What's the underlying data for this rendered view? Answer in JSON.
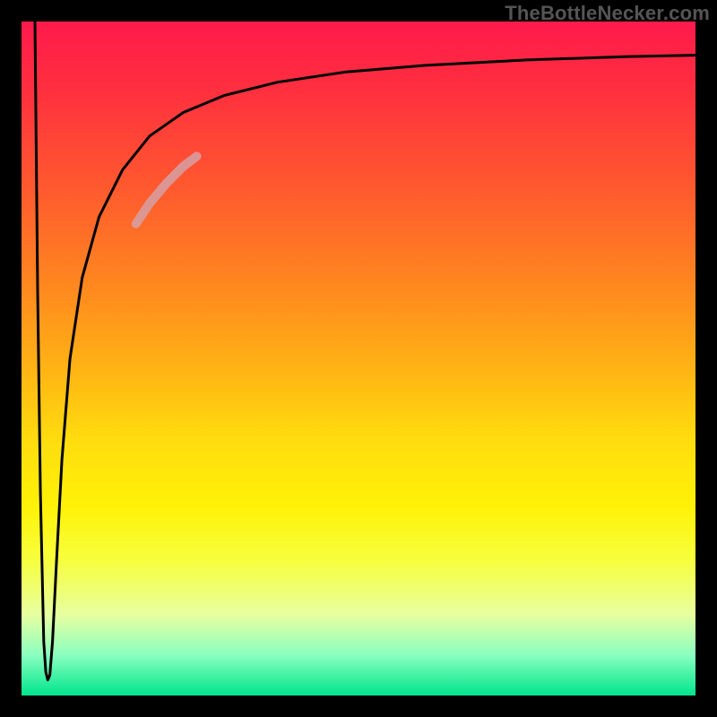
{
  "watermark": "TheBottleNecker.com",
  "chart_data": {
    "type": "line",
    "title": "",
    "xlabel": "",
    "ylabel": "",
    "xlim": [
      0,
      100
    ],
    "ylim": [
      0,
      100
    ],
    "background_gradient": {
      "direction": "vertical",
      "stops": [
        {
          "pos": 0.0,
          "color": "#ff1a4b"
        },
        {
          "pos": 0.5,
          "color": "#ffa91a"
        },
        {
          "pos": 0.75,
          "color": "#fff000"
        },
        {
          "pos": 1.0,
          "color": "#00e58c"
        }
      ]
    },
    "series": [
      {
        "name": "curve",
        "color": "#000000",
        "x": [
          2.0,
          2.4,
          2.8,
          3.3,
          3.6,
          3.9,
          4.2,
          4.6,
          5.2,
          6.0,
          7.2,
          9.0,
          11.5,
          15.0,
          19.0,
          24.0,
          30.0,
          38.0,
          48.0,
          60.0,
          75.0,
          90.0,
          100.0
        ],
        "y": [
          100.0,
          60.0,
          30.0,
          8.0,
          3.5,
          2.3,
          3.0,
          8.0,
          20.0,
          35.0,
          50.0,
          62.0,
          71.0,
          78.0,
          83.0,
          86.5,
          89.0,
          91.0,
          92.5,
          93.5,
          94.3,
          94.8,
          95.0
        ]
      },
      {
        "name": "highlight-segment",
        "color": "#d6a0a5",
        "thickness": 10,
        "x": [
          17.0,
          19.0,
          21.5,
          24.0,
          26.0
        ],
        "y": [
          70.0,
          73.0,
          76.0,
          78.5,
          80.0
        ]
      }
    ],
    "notes": "Axis values are unlabeled in the source image; x and y are expressed as percentages of the plotting area (0 = left/bottom, 100 = right/top). Values are visual estimates."
  }
}
